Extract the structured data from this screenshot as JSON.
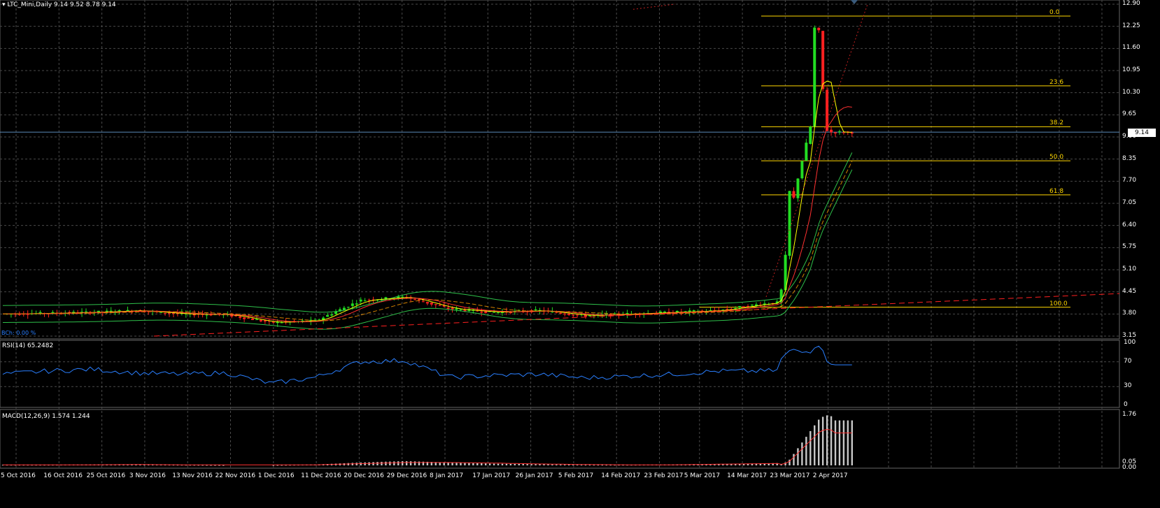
{
  "main_chart": {
    "symbol": "LTC_Mini,Daily",
    "ohlc": "9.14 9.52 8.78 9.14",
    "current_price": "9.14",
    "price_axis": [
      "12.90",
      "12.25",
      "11.60",
      "10.95",
      "10.30",
      "9.65",
      "9.00",
      "8.35",
      "7.70",
      "7.05",
      "6.40",
      "5.75",
      "5.10",
      "4.45",
      "3.80",
      "3.15"
    ],
    "fib_levels": [
      "0.0",
      "23.6",
      "38.2",
      "50.0",
      "61.8",
      "100.0"
    ],
    "bottom_left_label": "BCh: 0.00 %"
  },
  "rsi_panel": {
    "title": "RSI(14) 65.2482",
    "axis": [
      "100",
      "70",
      "30",
      "0"
    ]
  },
  "macd_panel": {
    "title": "MACD(12,26,9) 1.574 1.244",
    "axis": [
      "1.76",
      "0.05",
      "0.00"
    ]
  },
  "time_axis": [
    "5 Oct 2016",
    "16 Oct 2016",
    "25 Oct 2016",
    "3 Nov 2016",
    "13 Nov 2016",
    "22 Nov 2016",
    "1 Dec 2016",
    "11 Dec 2016",
    "20 Dec 2016",
    "29 Dec 2016",
    "8 Jan 2017",
    "17 Jan 2017",
    "26 Jan 2017",
    "5 Feb 2017",
    "14 Feb 2017",
    "23 Feb 2017",
    "5 Mar 2017",
    "14 Mar 2017",
    "23 Mar 2017",
    "2 Apr 2017"
  ],
  "colors": {
    "background": "#000000",
    "grid": "#4a4a4a",
    "bull": "#22dd22",
    "bear": "#ff2020",
    "fib": "#ffd700",
    "rsi": "#2a7fff",
    "macd_signal": "#ff3030",
    "macd_hist": "#c8c8c8"
  },
  "chart_data": [
    {
      "type": "candlestick",
      "title": "LTC_Mini,Daily",
      "ylim": [
        3.15,
        12.9
      ],
      "x": [
        "5 Oct 2016",
        "16 Oct 2016",
        "25 Oct 2016",
        "3 Nov 2016",
        "13 Nov 2016",
        "22 Nov 2016",
        "1 Dec 2016",
        "11 Dec 2016",
        "20 Dec 2016",
        "29 Dec 2016",
        "8 Jan 2017",
        "17 Jan 2017",
        "26 Jan 2017",
        "5 Feb 2017",
        "14 Feb 2017",
        "23 Feb 2017",
        "5 Mar 2017",
        "14 Mar 2017",
        "23 Mar 2017",
        "2 Apr 2017"
      ],
      "close_approx": [
        3.8,
        3.82,
        3.85,
        3.9,
        3.8,
        3.78,
        3.55,
        3.6,
        4.2,
        4.3,
        3.95,
        3.85,
        3.9,
        3.75,
        3.8,
        3.85,
        3.9,
        4.1,
        4.2,
        9.14
      ],
      "fib_retracement": {
        "0.0": 12.55,
        "23.6": 10.5,
        "38.2": 9.3,
        "50.0": 8.3,
        "61.8": 7.3,
        "100.0": 4.0
      }
    },
    {
      "type": "line",
      "title": "RSI(14) 65.2482",
      "ylim": [
        0,
        100
      ],
      "x": [
        "5 Oct 2016",
        "16 Oct 2016",
        "25 Oct 2016",
        "3 Nov 2016",
        "13 Nov 2016",
        "22 Nov 2016",
        "1 Dec 2016",
        "11 Dec 2016",
        "20 Dec 2016",
        "29 Dec 2016",
        "8 Jan 2017",
        "17 Jan 2017",
        "26 Jan 2017",
        "5 Feb 2017",
        "14 Feb 2017",
        "23 Feb 2017",
        "5 Mar 2017",
        "14 Mar 2017",
        "23 Mar 2017",
        "2 Apr 2017"
      ],
      "values": [
        50,
        55,
        58,
        52,
        50,
        52,
        35,
        45,
        70,
        72,
        45,
        48,
        50,
        44,
        47,
        50,
        55,
        55,
        58,
        65
      ]
    },
    {
      "type": "bar",
      "title": "MACD(12,26,9) 1.574 1.244",
      "ylim": [
        0,
        1.76
      ],
      "x": [
        "5 Oct 2016",
        "16 Oct 2016",
        "25 Oct 2016",
        "3 Nov 2016",
        "13 Nov 2016",
        "22 Nov 2016",
        "1 Dec 2016",
        "11 Dec 2016",
        "20 Dec 2016",
        "29 Dec 2016",
        "8 Jan 2017",
        "17 Jan 2017",
        "26 Jan 2017",
        "5 Feb 2017",
        "14 Feb 2017",
        "23 Feb 2017",
        "5 Mar 2017",
        "14 Mar 2017",
        "23 Mar 2017",
        "2 Apr 2017"
      ],
      "values": [
        0.02,
        0.02,
        0.03,
        0.03,
        0.02,
        0.01,
        0.01,
        0.03,
        0.1,
        0.15,
        0.1,
        0.06,
        0.04,
        0.02,
        0.02,
        0.03,
        0.05,
        0.07,
        0.1,
        1.57
      ],
      "signal": [
        0.02,
        0.02,
        0.02,
        0.03,
        0.02,
        0.02,
        0.02,
        0.02,
        0.06,
        0.1,
        0.1,
        0.08,
        0.05,
        0.03,
        0.02,
        0.02,
        0.04,
        0.06,
        0.08,
        1.24
      ]
    }
  ]
}
